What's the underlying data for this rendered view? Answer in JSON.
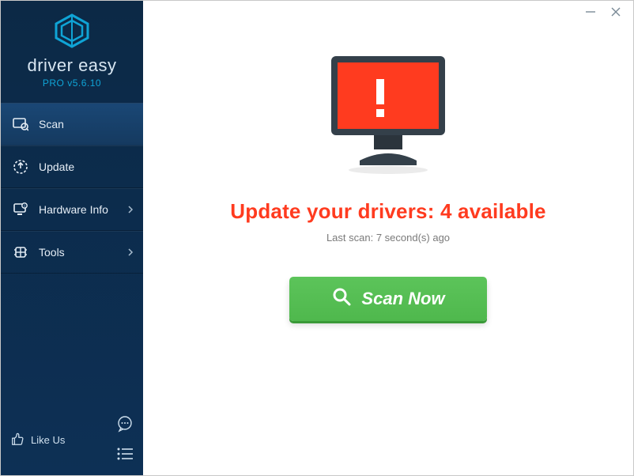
{
  "brand": {
    "name": "driver easy",
    "version_label": "PRO v5.6.10"
  },
  "sidebar": {
    "items": [
      {
        "label": "Scan",
        "has_chevron": false
      },
      {
        "label": "Update",
        "has_chevron": false
      },
      {
        "label": "Hardware Info",
        "has_chevron": true
      },
      {
        "label": "Tools",
        "has_chevron": true
      }
    ],
    "like_us_label": "Like Us"
  },
  "main": {
    "headline": "Update your drivers: 4 available",
    "subline": "Last scan: 7 second(s) ago",
    "scan_button_label": "Scan Now"
  },
  "colors": {
    "accent_red": "#ff3b1f",
    "accent_green": "#54bf52",
    "sidebar_bg_top": "#0c2946",
    "brand_teal": "#0fa4d6"
  }
}
